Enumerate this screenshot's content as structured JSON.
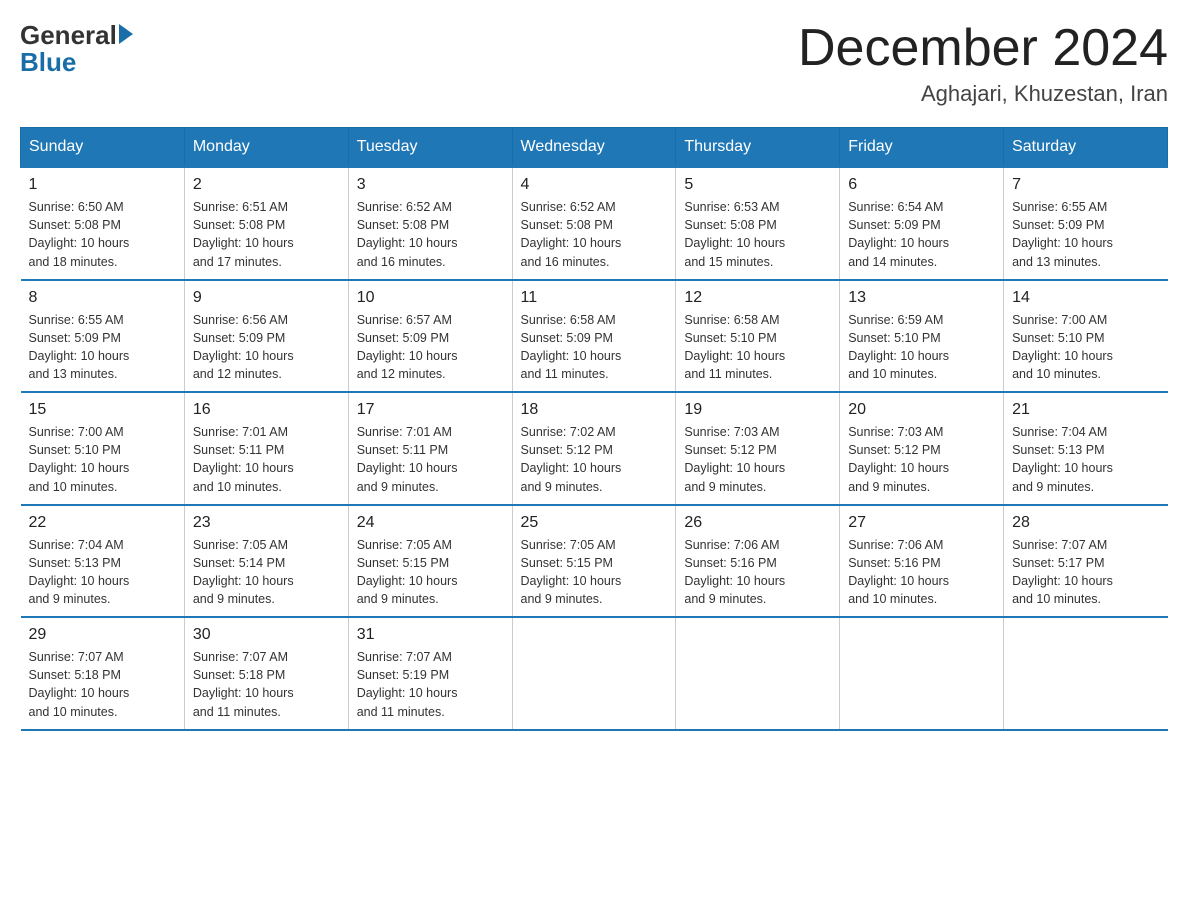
{
  "logo": {
    "general": "General",
    "arrow_color": "#1a6ea8",
    "blue": "Blue"
  },
  "title": "December 2024",
  "subtitle": "Aghajari, Khuzestan, Iran",
  "header_color": "#2077b5",
  "days_of_week": [
    "Sunday",
    "Monday",
    "Tuesday",
    "Wednesday",
    "Thursday",
    "Friday",
    "Saturday"
  ],
  "weeks": [
    [
      {
        "day": "1",
        "info": "Sunrise: 6:50 AM\nSunset: 5:08 PM\nDaylight: 10 hours\nand 18 minutes."
      },
      {
        "day": "2",
        "info": "Sunrise: 6:51 AM\nSunset: 5:08 PM\nDaylight: 10 hours\nand 17 minutes."
      },
      {
        "day": "3",
        "info": "Sunrise: 6:52 AM\nSunset: 5:08 PM\nDaylight: 10 hours\nand 16 minutes."
      },
      {
        "day": "4",
        "info": "Sunrise: 6:52 AM\nSunset: 5:08 PM\nDaylight: 10 hours\nand 16 minutes."
      },
      {
        "day": "5",
        "info": "Sunrise: 6:53 AM\nSunset: 5:08 PM\nDaylight: 10 hours\nand 15 minutes."
      },
      {
        "day": "6",
        "info": "Sunrise: 6:54 AM\nSunset: 5:09 PM\nDaylight: 10 hours\nand 14 minutes."
      },
      {
        "day": "7",
        "info": "Sunrise: 6:55 AM\nSunset: 5:09 PM\nDaylight: 10 hours\nand 13 minutes."
      }
    ],
    [
      {
        "day": "8",
        "info": "Sunrise: 6:55 AM\nSunset: 5:09 PM\nDaylight: 10 hours\nand 13 minutes."
      },
      {
        "day": "9",
        "info": "Sunrise: 6:56 AM\nSunset: 5:09 PM\nDaylight: 10 hours\nand 12 minutes."
      },
      {
        "day": "10",
        "info": "Sunrise: 6:57 AM\nSunset: 5:09 PM\nDaylight: 10 hours\nand 12 minutes."
      },
      {
        "day": "11",
        "info": "Sunrise: 6:58 AM\nSunset: 5:09 PM\nDaylight: 10 hours\nand 11 minutes."
      },
      {
        "day": "12",
        "info": "Sunrise: 6:58 AM\nSunset: 5:10 PM\nDaylight: 10 hours\nand 11 minutes."
      },
      {
        "day": "13",
        "info": "Sunrise: 6:59 AM\nSunset: 5:10 PM\nDaylight: 10 hours\nand 10 minutes."
      },
      {
        "day": "14",
        "info": "Sunrise: 7:00 AM\nSunset: 5:10 PM\nDaylight: 10 hours\nand 10 minutes."
      }
    ],
    [
      {
        "day": "15",
        "info": "Sunrise: 7:00 AM\nSunset: 5:10 PM\nDaylight: 10 hours\nand 10 minutes."
      },
      {
        "day": "16",
        "info": "Sunrise: 7:01 AM\nSunset: 5:11 PM\nDaylight: 10 hours\nand 10 minutes."
      },
      {
        "day": "17",
        "info": "Sunrise: 7:01 AM\nSunset: 5:11 PM\nDaylight: 10 hours\nand 9 minutes."
      },
      {
        "day": "18",
        "info": "Sunrise: 7:02 AM\nSunset: 5:12 PM\nDaylight: 10 hours\nand 9 minutes."
      },
      {
        "day": "19",
        "info": "Sunrise: 7:03 AM\nSunset: 5:12 PM\nDaylight: 10 hours\nand 9 minutes."
      },
      {
        "day": "20",
        "info": "Sunrise: 7:03 AM\nSunset: 5:12 PM\nDaylight: 10 hours\nand 9 minutes."
      },
      {
        "day": "21",
        "info": "Sunrise: 7:04 AM\nSunset: 5:13 PM\nDaylight: 10 hours\nand 9 minutes."
      }
    ],
    [
      {
        "day": "22",
        "info": "Sunrise: 7:04 AM\nSunset: 5:13 PM\nDaylight: 10 hours\nand 9 minutes."
      },
      {
        "day": "23",
        "info": "Sunrise: 7:05 AM\nSunset: 5:14 PM\nDaylight: 10 hours\nand 9 minutes."
      },
      {
        "day": "24",
        "info": "Sunrise: 7:05 AM\nSunset: 5:15 PM\nDaylight: 10 hours\nand 9 minutes."
      },
      {
        "day": "25",
        "info": "Sunrise: 7:05 AM\nSunset: 5:15 PM\nDaylight: 10 hours\nand 9 minutes."
      },
      {
        "day": "26",
        "info": "Sunrise: 7:06 AM\nSunset: 5:16 PM\nDaylight: 10 hours\nand 9 minutes."
      },
      {
        "day": "27",
        "info": "Sunrise: 7:06 AM\nSunset: 5:16 PM\nDaylight: 10 hours\nand 10 minutes."
      },
      {
        "day": "28",
        "info": "Sunrise: 7:07 AM\nSunset: 5:17 PM\nDaylight: 10 hours\nand 10 minutes."
      }
    ],
    [
      {
        "day": "29",
        "info": "Sunrise: 7:07 AM\nSunset: 5:18 PM\nDaylight: 10 hours\nand 10 minutes."
      },
      {
        "day": "30",
        "info": "Sunrise: 7:07 AM\nSunset: 5:18 PM\nDaylight: 10 hours\nand 11 minutes."
      },
      {
        "day": "31",
        "info": "Sunrise: 7:07 AM\nSunset: 5:19 PM\nDaylight: 10 hours\nand 11 minutes."
      },
      {
        "day": "",
        "info": ""
      },
      {
        "day": "",
        "info": ""
      },
      {
        "day": "",
        "info": ""
      },
      {
        "day": "",
        "info": ""
      }
    ]
  ]
}
